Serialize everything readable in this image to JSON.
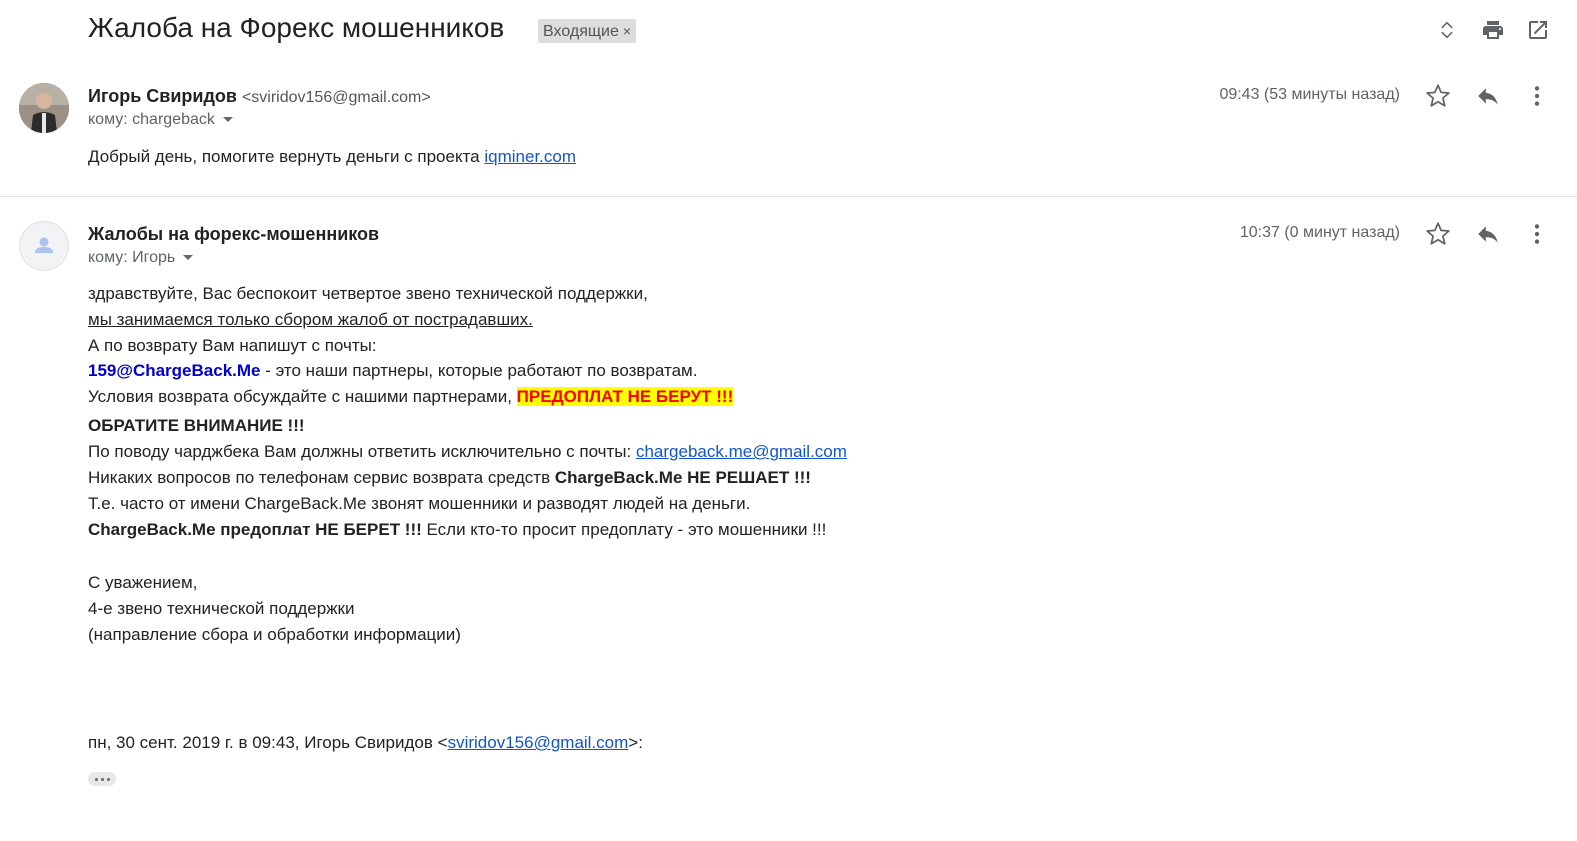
{
  "subject": "Жалоба на Форекс мошенников",
  "label": {
    "text": "Входящие",
    "remove": "×"
  },
  "toolbar_icons": [
    "expand-collapse-icon",
    "print-icon",
    "open-new-window-icon"
  ],
  "messages": [
    {
      "sender_name": "Игорь Свиридов",
      "sender_email": "<sviridov156@gmail.com>",
      "to": "кому: chargeback",
      "time": "09:43 (53 минуты назад)",
      "body": {
        "pre": "Добрый день, помогите вернуть деньги с проекта ",
        "link": "iqminer.com"
      }
    },
    {
      "sender_name": "Жалобы на форекс-мошенников",
      "to": "кому: Игорь",
      "time": "10:37 (0 минут назад)",
      "body": {
        "line1": "здравствуйте, Вас беспокоит четвертое звено технической поддержки,",
        "line2": "мы занимаемся только сбором жалоб от пострадавших.",
        "line3": "А по возврату Вам напишут с почты:",
        "line4_email": "159@ChargeBack.Me",
        "line4_rest": " - это наши партнеры, которые работают по возвратам.",
        "line5_pre": "Условия возврата обсуждайте с нашими партнерами, ",
        "line5_highlight": "ПРЕДОПЛАТ НЕ БЕРУТ !!!",
        "line6": "ОБРАТИТЕ ВНИМАНИЕ !!!",
        "line7_pre": "По поводу чарджбека Вам должны ответить исключительно с почты: ",
        "line7_link": "chargeback.me@gmail.com",
        "line8_pre": "Никаких вопросов по телефонам сервис возврата средств ",
        "line8_bold": "ChargeBack.Me НЕ РЕШАЕТ !!!",
        "line9": "Т.е. часто от имени ChargeBack.Me звонят мошенники и разводят людей на деньги.",
        "line10_bold": "ChargeBack.Me предоплат НЕ БЕРЕТ !!!",
        "line10_rest": " Если кто-то просит предоплату - это мошенники !!!",
        "sig1": "С уважением,",
        "sig2": "4-е звено технической поддержки",
        "sig3": "(направление сбора и обработки информации)",
        "quote_pre": "пн, 30 сент. 2019 г. в 09:43, Игорь Свиридов <",
        "quote_link": "sviridov156@gmail.com",
        "quote_post": ">:"
      }
    }
  ],
  "colors": {
    "link": "#1155cc",
    "highlight_bg": "#ffff00",
    "highlight_text": "#ff0000",
    "email_blue": "#0000cc"
  }
}
